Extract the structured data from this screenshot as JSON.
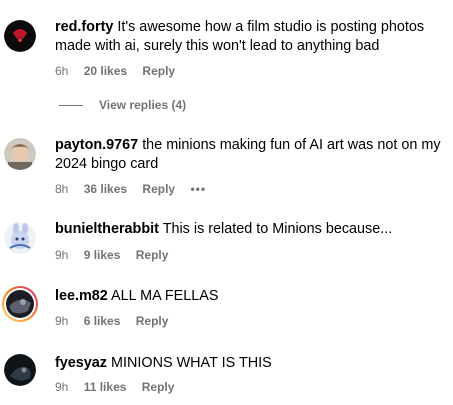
{
  "comments": [
    {
      "username": "red.forty",
      "text": "It's awesome how a film studio is posting photos made with ai, surely this won't lead to anything bad",
      "time": "6h",
      "likes": "20 likes",
      "reply": "Reply"
    },
    {
      "username": "payton.9767",
      "text": "the minions making fun of AI art was not on my 2024 bingo card",
      "time": "8h",
      "likes": "36 likes",
      "reply": "Reply",
      "more": "•••"
    },
    {
      "username": "bunieltherabbit",
      "text": "This is related to Minions because...",
      "time": "9h",
      "likes": "9 likes",
      "reply": "Reply"
    },
    {
      "username": "lee.m82",
      "text": "ALL MA FELLAS",
      "time": "9h",
      "likes": "6 likes",
      "reply": "Reply"
    },
    {
      "username": "fyesyaz",
      "text": "MINIONS WHAT IS THIS",
      "time": "9h",
      "likes": "11 likes",
      "reply": "Reply"
    }
  ],
  "view_replies": "View replies (4)",
  "colors": {
    "secondary_text": "#737373",
    "story_ring_start": "#feda75",
    "story_ring_end": "#d62976"
  }
}
